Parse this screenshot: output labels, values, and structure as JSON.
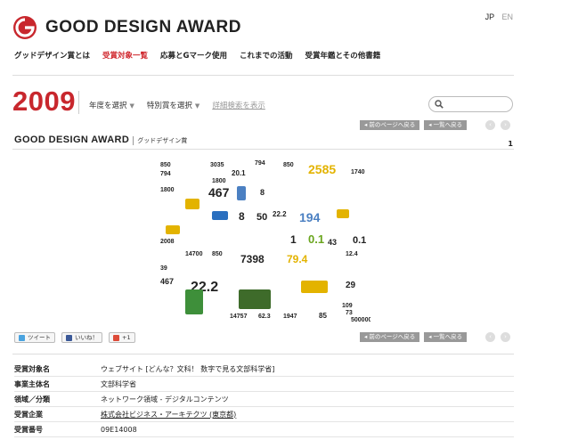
{
  "brand": {
    "name": "GOOD DESIGN AWARD",
    "accent": "#c8272d"
  },
  "lang": {
    "current": "JP",
    "other": "EN"
  },
  "gnav": [
    {
      "label": "グッドデザイン賞とは",
      "active": false
    },
    {
      "label": "受賞対象一覧",
      "active": true
    },
    {
      "label": "応募とGマーク使用",
      "active": false
    },
    {
      "label": "これまでの活動",
      "active": false
    },
    {
      "label": "受賞年鑑とその他書籍",
      "active": false
    }
  ],
  "filter": {
    "year": "2009",
    "by_year": "年度を選択",
    "by_special": "特別賞を選択",
    "advanced": "詳細検索を表示",
    "search_placeholder": ""
  },
  "pager": {
    "prev": "前のページへ戻る",
    "list": "一覧へ戻る",
    "left_arrow": "‹",
    "right_arrow": "›"
  },
  "section": {
    "title": "GOOD DESIGN AWARD",
    "subtitle": "グッドデザイン賞",
    "count": "1"
  },
  "hero_numbers": [
    "850",
    "794",
    "3035",
    "20.1",
    "794",
    "850",
    "2585",
    "467",
    "8",
    "1800",
    "22.2",
    "194",
    "8",
    "50",
    "7398",
    "79.4",
    "0.1",
    "43",
    "0.1",
    "1",
    "2008",
    "14700",
    "850",
    "39",
    "467",
    "29",
    "22.2",
    "14757",
    "62.3",
    "1947",
    "85",
    "109",
    "73",
    "500000",
    "12.4",
    "1740",
    "1800"
  ],
  "social": {
    "tweet": "ツイート",
    "like": "いいね！",
    "plus": "+1"
  },
  "details": [
    {
      "key": "受賞対象名",
      "value": "ウェブサイト [どんな？文科！ 数字で見る文部科学省]",
      "link": false
    },
    {
      "key": "事業主体名",
      "value": "文部科学省",
      "link": false
    },
    {
      "key": "領域／分類",
      "value": "ネットワーク領域 - デジタルコンテンツ",
      "link": false
    },
    {
      "key": "受賞企業",
      "value": "株式会社ビジネス・アーキテクツ (東京都)",
      "link": true
    },
    {
      "key": "受賞番号",
      "value": "09E14008",
      "link": false
    }
  ]
}
